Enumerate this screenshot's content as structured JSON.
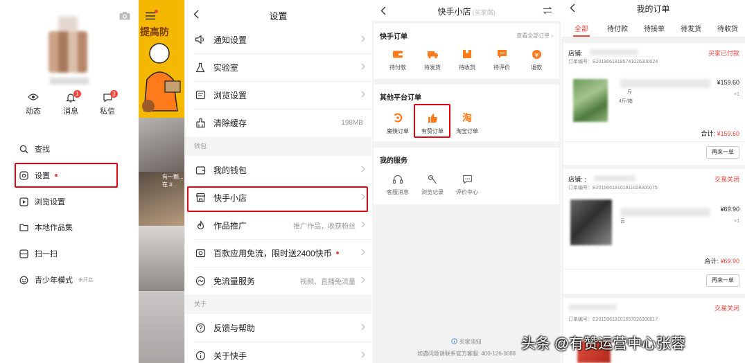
{
  "drawer": {
    "quick_items": [
      {
        "label": "动态",
        "icon": "eye-icon"
      },
      {
        "label": "消息",
        "icon": "bell-icon",
        "badge": "1"
      },
      {
        "label": "私信",
        "icon": "chat-icon",
        "badge": "3"
      }
    ],
    "menu": [
      {
        "label": "查找",
        "icon": "search-icon"
      },
      {
        "label": "设置",
        "icon": "gear-icon"
      },
      {
        "label": "浏览设置",
        "icon": "play-square-icon"
      },
      {
        "label": "本地作品集",
        "icon": "folder-icon"
      },
      {
        "label": "扫一扫",
        "icon": "scan-icon"
      },
      {
        "label": "青少年模式",
        "icon": "teen-mode-icon",
        "tag": "未开启"
      }
    ]
  },
  "feed_strip": {
    "tile1_text": "提高防",
    "tile3_text": "有一颗...",
    "tile3_text2": "在 #..."
  },
  "settings": {
    "title": "设置",
    "items_a": [
      {
        "label": "通知设置",
        "icon": "speaker-icon"
      },
      {
        "label": "实验室",
        "icon": "flask-icon"
      },
      {
        "label": "浏览设置",
        "icon": "browse-icon"
      },
      {
        "label": "清除缓存",
        "icon": "broom-icon",
        "value": "198MB"
      }
    ],
    "section_wallet": "钱包",
    "items_b": [
      {
        "label": "我的钱包",
        "icon": "wallet-icon"
      },
      {
        "label": "快手小店",
        "icon": "shop-icon"
      },
      {
        "label": "作品推广",
        "icon": "flame-icon",
        "value": "推广作品，收获粉丝"
      },
      {
        "label": "百款应用免流，限时送2400快币",
        "icon": "app-coin-icon",
        "dot": true
      },
      {
        "label": "免流量服务",
        "icon": "data-free-icon",
        "value": "视频、直播免流量"
      }
    ],
    "section_about": "关于",
    "items_c": [
      {
        "label": "反馈与帮助",
        "icon": "question-icon"
      },
      {
        "label": "关于快手",
        "icon": "info-icon"
      }
    ]
  },
  "shop": {
    "title": "快手小店",
    "title_suffix": "(买家端)",
    "orders_head": "快手订单",
    "orders_more": "查看全部订单",
    "order_items": [
      {
        "label": "待付款",
        "icon": "wallet-orange-icon"
      },
      {
        "label": "待发货",
        "icon": "truck-icon"
      },
      {
        "label": "待收货",
        "icon": "box-icon"
      },
      {
        "label": "待评价",
        "icon": "comment-icon"
      },
      {
        "label": "退款",
        "icon": "refund-icon"
      }
    ],
    "other_head": "其他平台订单",
    "other_items": [
      {
        "label": "魔筷订单",
        "icon": "mokuai-icon"
      },
      {
        "label": "有赞订单",
        "icon": "thumbs-up-icon"
      },
      {
        "label": "淘宝订单",
        "icon": "taobao-icon",
        "glyph": "淘"
      }
    ],
    "services_head": "我的服务",
    "services": [
      {
        "label": "客服消息",
        "icon": "headset-icon"
      },
      {
        "label": "浏览记录",
        "icon": "history-icon"
      },
      {
        "label": "评价中心",
        "icon": "review-icon"
      }
    ],
    "notice": "买家须知",
    "contact": "如遇问题请联系官方客服: 400-126-0088"
  },
  "orders": {
    "title": "我的订单",
    "tabs": [
      "全部",
      "待付款",
      "待接单",
      "待发货",
      "待收货"
    ],
    "active_tab": 0,
    "list": [
      {
        "shop": "店铺:",
        "status": "买家已付款",
        "order_no": "订单编号：E20190618185741026300024",
        "spec_a": "斤",
        "spec_b": "4斤/箱",
        "price": "¥159.60",
        "qty": "×1",
        "total_label": "合计:",
        "total": "¥159.60",
        "button": "再来一单"
      },
      {
        "shop": "店铺: ;",
        "status": "交易关闭",
        "order_no": "订单编号：E20190618101811026300075",
        "spec_a": "云",
        "price": "¥69.90",
        "qty": "×1",
        "total_label": "合计:",
        "total": "¥69.90",
        "button": "再来一单"
      },
      {
        "status": "交易关闭",
        "order_no": "订单编号：E20190618101657026300017"
      }
    ]
  },
  "watermark": "头条 @有赞运营中心张蓉",
  "colors": {
    "accent": "#f2453d",
    "highlight_box": "#e60012",
    "icon_orange": "#ff7a1a"
  }
}
